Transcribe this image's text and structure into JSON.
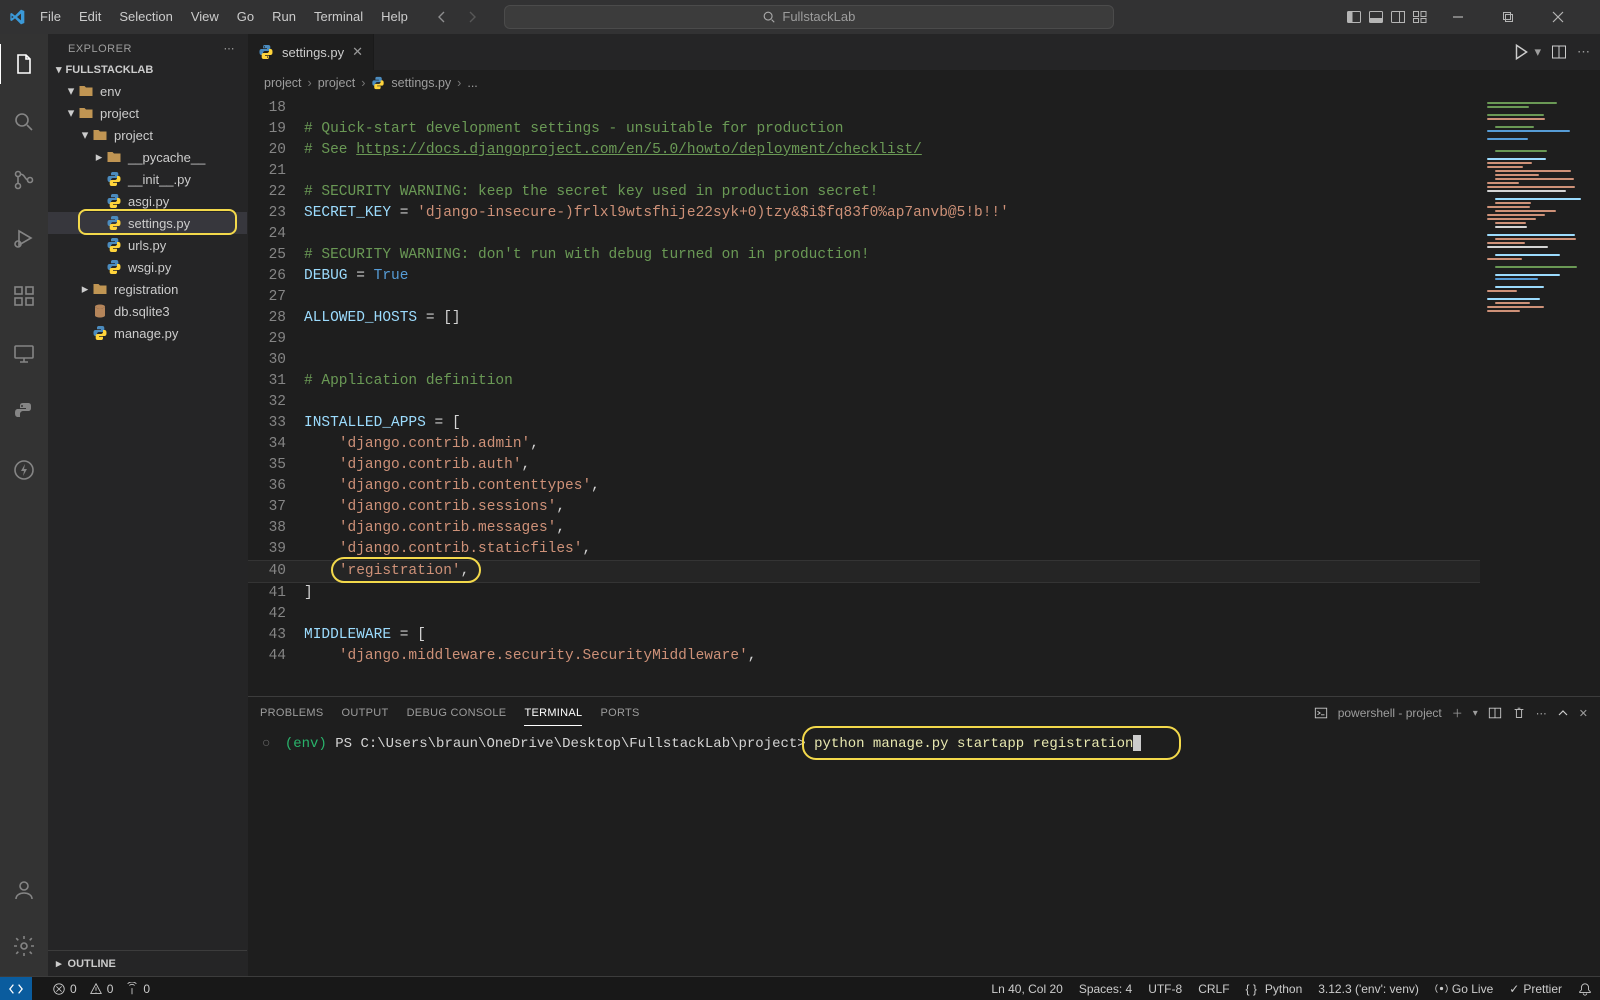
{
  "titlebar": {
    "menus": [
      "File",
      "Edit",
      "Selection",
      "View",
      "Go",
      "Run",
      "Terminal",
      "Help"
    ],
    "search_placeholder": "FullstackLab"
  },
  "sidebar": {
    "title": "EXPLORER",
    "project": "FULLSTACKLAB",
    "outline": "OUTLINE",
    "tree": [
      {
        "depth": 0,
        "chev": "▾",
        "icon": "folder",
        "label": "env"
      },
      {
        "depth": 0,
        "chev": "▾",
        "icon": "folder",
        "label": "project"
      },
      {
        "depth": 1,
        "chev": "▾",
        "icon": "folder",
        "label": "project"
      },
      {
        "depth": 2,
        "chev": "▸",
        "icon": "folder",
        "label": "__pycache__"
      },
      {
        "depth": 2,
        "chev": "",
        "icon": "py",
        "label": "__init__.py"
      },
      {
        "depth": 2,
        "chev": "",
        "icon": "py",
        "label": "asgi.py"
      },
      {
        "depth": 2,
        "chev": "",
        "icon": "py",
        "label": "settings.py",
        "selected": true,
        "highlight": true
      },
      {
        "depth": 2,
        "chev": "",
        "icon": "py",
        "label": "urls.py"
      },
      {
        "depth": 2,
        "chev": "",
        "icon": "py",
        "label": "wsgi.py"
      },
      {
        "depth": 1,
        "chev": "▸",
        "icon": "folder",
        "label": "registration"
      },
      {
        "depth": 1,
        "chev": "",
        "icon": "db",
        "label": "db.sqlite3"
      },
      {
        "depth": 1,
        "chev": "",
        "icon": "py",
        "label": "manage.py"
      }
    ]
  },
  "tab": {
    "filename": "settings.py"
  },
  "breadcrumb": {
    "seg1": "project",
    "seg2": "project",
    "seg3": "settings.py",
    "seg4": "..."
  },
  "code": {
    "start": 18,
    "current_line": 40,
    "lines": [
      {
        "n": 18,
        "seg": [
          [
            "",
            ""
          ]
        ]
      },
      {
        "n": 19,
        "seg": [
          [
            "c-comment",
            "# Quick-start development settings - unsuitable for production"
          ]
        ]
      },
      {
        "n": 20,
        "seg": [
          [
            "c-comment",
            "# See "
          ],
          [
            "c-link",
            "https://docs.djangoproject.com/en/5.0/howto/deployment/checklist/"
          ]
        ]
      },
      {
        "n": 21,
        "seg": [
          [
            "",
            ""
          ]
        ]
      },
      {
        "n": 22,
        "seg": [
          [
            "c-comment",
            "# SECURITY WARNING: keep the secret key used in production secret!"
          ]
        ]
      },
      {
        "n": 23,
        "seg": [
          [
            "c-var",
            "SECRET_KEY"
          ],
          [
            "c-op",
            " = "
          ],
          [
            "c-str",
            "'django-insecure-)frlxl9wtsfhije22syk+0)tzy&$i$fq83f0%ap7anvb@5!b!!'"
          ]
        ]
      },
      {
        "n": 24,
        "seg": [
          [
            "",
            ""
          ]
        ]
      },
      {
        "n": 25,
        "seg": [
          [
            "c-comment",
            "# SECURITY WARNING: don't run with debug turned on in production!"
          ]
        ]
      },
      {
        "n": 26,
        "seg": [
          [
            "c-var",
            "DEBUG"
          ],
          [
            "c-op",
            " = "
          ],
          [
            "c-bool",
            "True"
          ]
        ]
      },
      {
        "n": 27,
        "seg": [
          [
            "",
            ""
          ]
        ]
      },
      {
        "n": 28,
        "seg": [
          [
            "c-var",
            "ALLOWED_HOSTS"
          ],
          [
            "c-op",
            " = "
          ],
          [
            "c-punc",
            "[]"
          ]
        ]
      },
      {
        "n": 29,
        "seg": [
          [
            "",
            ""
          ]
        ]
      },
      {
        "n": 30,
        "seg": [
          [
            "",
            ""
          ]
        ]
      },
      {
        "n": 31,
        "seg": [
          [
            "c-comment",
            "# Application definition"
          ]
        ]
      },
      {
        "n": 32,
        "seg": [
          [
            "",
            ""
          ]
        ]
      },
      {
        "n": 33,
        "seg": [
          [
            "c-var",
            "INSTALLED_APPS"
          ],
          [
            "c-op",
            " = "
          ],
          [
            "c-punc",
            "["
          ]
        ]
      },
      {
        "n": 34,
        "seg": [
          [
            "",
            "    "
          ],
          [
            "c-str",
            "'django.contrib.admin'"
          ],
          [
            "c-punc",
            ","
          ]
        ]
      },
      {
        "n": 35,
        "seg": [
          [
            "",
            "    "
          ],
          [
            "c-str",
            "'django.contrib.auth'"
          ],
          [
            "c-punc",
            ","
          ]
        ]
      },
      {
        "n": 36,
        "seg": [
          [
            "",
            "    "
          ],
          [
            "c-str",
            "'django.contrib.contenttypes'"
          ],
          [
            "c-punc",
            ","
          ]
        ]
      },
      {
        "n": 37,
        "seg": [
          [
            "",
            "    "
          ],
          [
            "c-str",
            "'django.contrib.sessions'"
          ],
          [
            "c-punc",
            ","
          ]
        ]
      },
      {
        "n": 38,
        "seg": [
          [
            "",
            "    "
          ],
          [
            "c-str",
            "'django.contrib.messages'"
          ],
          [
            "c-punc",
            ","
          ]
        ]
      },
      {
        "n": 39,
        "seg": [
          [
            "",
            "    "
          ],
          [
            "c-str",
            "'django.contrib.staticfiles'"
          ],
          [
            "c-punc",
            ","
          ]
        ]
      },
      {
        "n": 40,
        "seg": [
          [
            "",
            "    "
          ],
          [
            "c-str",
            "'registration'"
          ],
          [
            "c-punc",
            ","
          ]
        ],
        "highlight": true
      },
      {
        "n": 41,
        "seg": [
          [
            "c-punc",
            "]"
          ]
        ]
      },
      {
        "n": 42,
        "seg": [
          [
            "",
            ""
          ]
        ]
      },
      {
        "n": 43,
        "seg": [
          [
            "c-var",
            "MIDDLEWARE"
          ],
          [
            "c-op",
            " = "
          ],
          [
            "c-punc",
            "["
          ]
        ]
      },
      {
        "n": 44,
        "seg": [
          [
            "",
            "    "
          ],
          [
            "c-str",
            "'django.middleware.security.SecurityMiddleware'"
          ],
          [
            "c-punc",
            ","
          ]
        ]
      }
    ]
  },
  "panel": {
    "tabs": {
      "problems": "PROBLEMS",
      "output": "OUTPUT",
      "debug": "DEBUG CONSOLE",
      "terminal": "TERMINAL",
      "ports": "PORTS"
    },
    "shell_label": "powershell - project",
    "prompt_env": "(env)",
    "prompt_path": "PS C:\\Users\\braun\\OneDrive\\Desktop\\FullstackLab\\project>",
    "command": "python manage.py startapp registration"
  },
  "statusbar": {
    "errors": "0",
    "warnings": "0",
    "ports": "0",
    "ln_col": "Ln 40, Col 20",
    "spaces": "Spaces: 4",
    "encoding": "UTF-8",
    "eol": "CRLF",
    "lang": "Python",
    "interpreter": "3.12.3 ('env': venv)",
    "golive": "Go Live",
    "prettier": "Prettier"
  }
}
